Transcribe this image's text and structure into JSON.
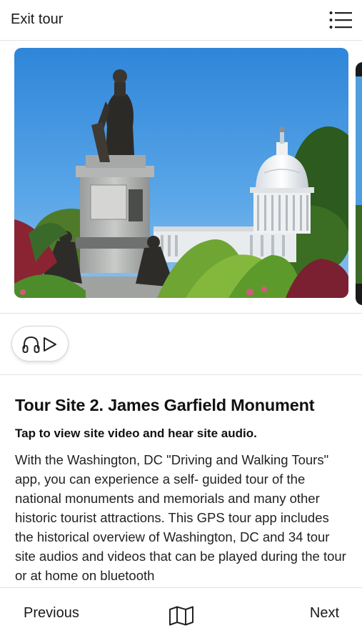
{
  "header": {
    "exit_label": "Exit tour",
    "menu_icon": "list-menu-icon"
  },
  "carousel": {
    "current_image": "capitol-garfield-statue-photo",
    "next_image": "next-site-photo-peek"
  },
  "audio": {
    "icons": [
      "headphones-icon",
      "play-icon"
    ]
  },
  "site": {
    "title": "Tour Site 2. James Garfield Monument",
    "subtitle": "Tap to view site video and hear site audio.",
    "description": "With the Washington, DC \"Driving and Walking Tours\" app, you can experience a self- guided tour of the national monuments and memorials and many other historic tourist attractions. This GPS tour app includes the historical overview of Washington, DC and 34 tour site audios and videos that can be played during the tour or at home on bluetooth"
  },
  "footer": {
    "previous_label": "Previous",
    "next_label": "Next",
    "map_icon": "map-icon"
  }
}
